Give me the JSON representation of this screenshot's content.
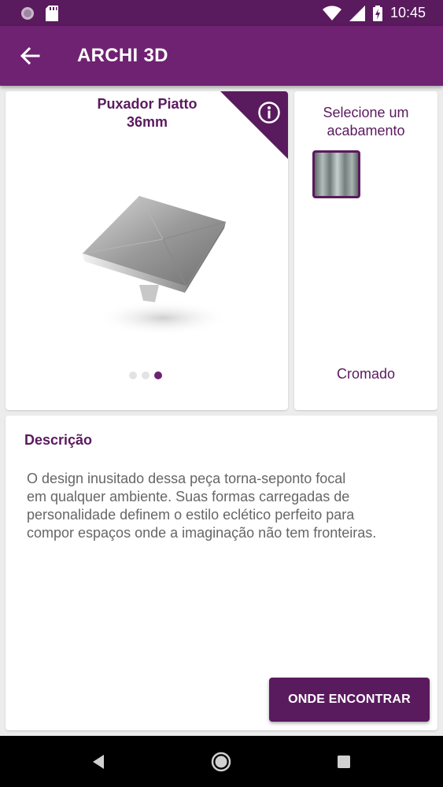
{
  "status_bar": {
    "time": "10:45",
    "icons": [
      "app-notification-icon",
      "sd-card-icon",
      "wifi-icon",
      "signal-icon",
      "battery-charging-icon"
    ]
  },
  "app_bar": {
    "title": "ARCHI 3D",
    "back_icon": "arrow-left-icon"
  },
  "product": {
    "title_line1": "Puxador Piatto",
    "title_line2": "36mm",
    "info_icon": "info-icon",
    "image_icon": "product-image",
    "carousel": {
      "total": 3,
      "active_index": 2
    }
  },
  "finish": {
    "heading_line1": "Selecione um",
    "heading_line2": "acabamento",
    "selected_name": "Cromado"
  },
  "description": {
    "heading": "Descrição",
    "lines": [
      "O design inusitado dessa peça torna-seponto focal",
      "em qualquer ambiente. Suas formas carregadas de",
      "personalidade definem o estilo eclético perfeito para",
      "compor espaços onde a imaginação não tem fronteiras."
    ],
    "button_label": "ONDE ENCONTRAR"
  },
  "nav_bar": {
    "icons": [
      "nav-back-icon",
      "nav-home-icon",
      "nav-recents-icon"
    ]
  },
  "colors": {
    "status_bar": "#5a1a5e",
    "app_bar": "#6f2272",
    "accent": "#5a1a5e",
    "background": "#ececec"
  }
}
